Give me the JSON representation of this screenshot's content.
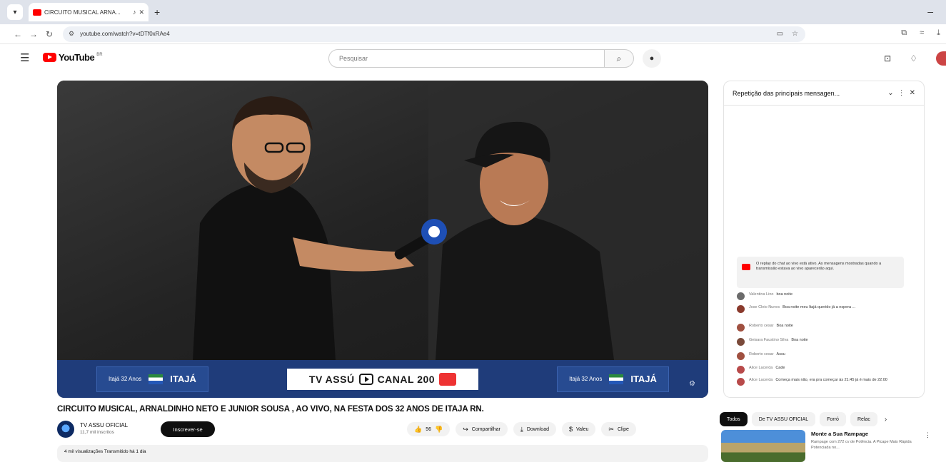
{
  "browser": {
    "tab_title": "CIRCUITO MUSICAL ARNA...",
    "url": "youtube.com/watch?v=tDTf0xRAe4",
    "tab_menu_glyph": "▾",
    "new_tab_glyph": "+",
    "minimize_glyph": "–"
  },
  "youtube": {
    "logo_text": "YouTube",
    "logo_country": "BR",
    "search_placeholder": "Pesquisar"
  },
  "video": {
    "title": "CIRCUITO MUSICAL, ARNALDINHO NETO E JUNIOR SOUSA , AO VIVO, NA FESTA DOS 32 ANOS DE ITAJA RN.",
    "channel_name": "TV ASSU OFICIAL",
    "channel_subs": "11,7 mil inscritos",
    "subscribe_label": "Inscrever-se",
    "likes": "56",
    "share_label": "Compartilhar",
    "download_label": "Download",
    "thanks_label": "Valeu",
    "clip_label": "Clipe",
    "description_meta": "4 mil visualizações  Transmitido há 1 dia"
  },
  "overlay": {
    "left_brand": "ITAJÁ",
    "left_small": "Itajá 32 Anos",
    "center_left": "TV ASSÚ",
    "center_right": "CANAL 200",
    "right_brand": "ITAJÁ",
    "right_small": "Itajá 32 Anos"
  },
  "chat": {
    "header": "Repetição das principais mensagen...",
    "replay_note": "O replay do chat ao vivo está ativo. As mensagens mostradas quando a transmissão estava ao vivo aparecerão aqui.",
    "messages": [
      {
        "author": "Valentina Lino",
        "text": "boa noite",
        "color": "#6b6b6b"
      },
      {
        "author": "Jose Cleio Nunes",
        "text": "Boa noite meu Itajá querido já a espera ...",
        "color": "#8a3a2c"
      },
      {
        "author": "Roberto cesar",
        "text": "Boa noite",
        "color": "#a05040"
      },
      {
        "author": "Geisara Faustino Silva",
        "text": "Boa noite",
        "color": "#7a4a3a"
      },
      {
        "author": "Roberto cesar",
        "text": "Assu",
        "color": "#a05040"
      },
      {
        "author": "Alice Lacerda",
        "text": "Cade",
        "color": "#b84a4a"
      },
      {
        "author": "Alice Lacerda",
        "text": "Começa mais não, era pra começar às 21:45 já é mais de 22:00",
        "color": "#b84a4a"
      }
    ]
  },
  "chips": [
    "Todos",
    "De TV ASSU OFICIAL",
    "Forró",
    "Relac"
  ],
  "recommendation": {
    "title": "Monte a Sua Rampage",
    "subtitle": "Rampage com 272 cv de Potência. A Picape Mais Rápida Potenciada no..."
  },
  "colors": {
    "youtube_red": "#ff0000",
    "banner_blue": "#1f3c7a",
    "subscribe_black": "#0f0f0f"
  }
}
